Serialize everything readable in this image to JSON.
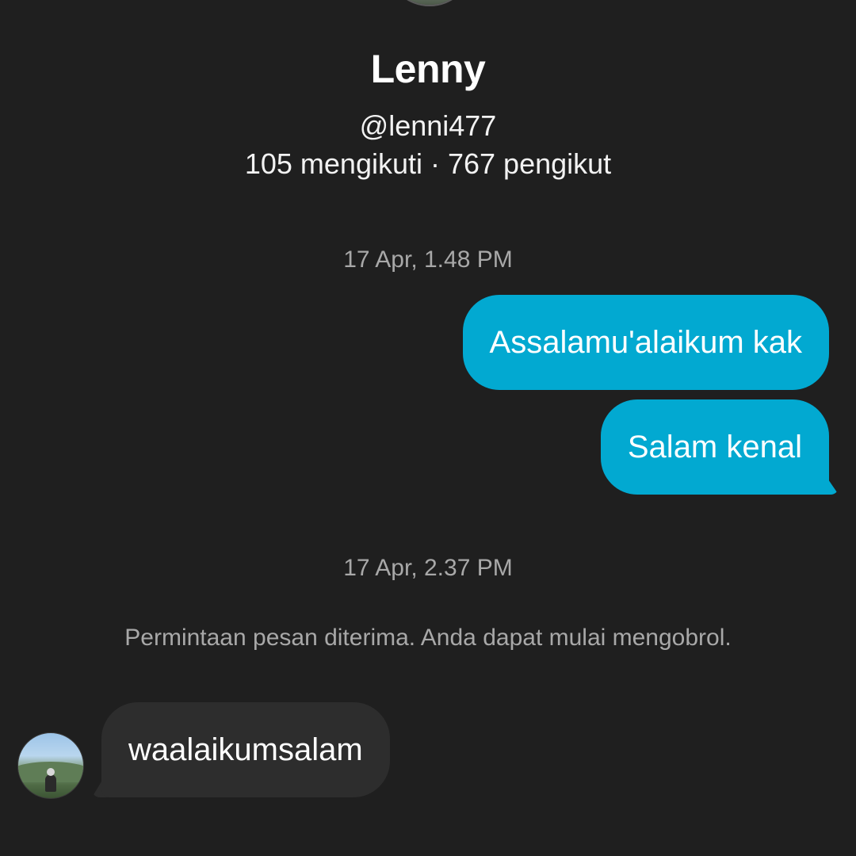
{
  "profile": {
    "name": "Lenny",
    "handle": "@lenni477",
    "stats": "105 mengikuti · 767 pengikut"
  },
  "messages": {
    "timestamp_1": "17 Apr, 1.48 PM",
    "outgoing": [
      "Assalamu'alaikum kak",
      "Salam kenal"
    ],
    "timestamp_2": "17 Apr, 2.37 PM",
    "system_note": "Permintaan pesan diterima. Anda dapat mulai mengobrol.",
    "incoming": [
      "waalaikumsalam"
    ]
  },
  "colors": {
    "background": "#1f1f1f",
    "outgoing_bubble": "#02a9d1",
    "incoming_bubble": "#2d2d2d",
    "muted_text": "#a8a8a8"
  },
  "icons": {
    "profile_avatar": "avatar-icon",
    "contact_avatar": "avatar-icon"
  }
}
